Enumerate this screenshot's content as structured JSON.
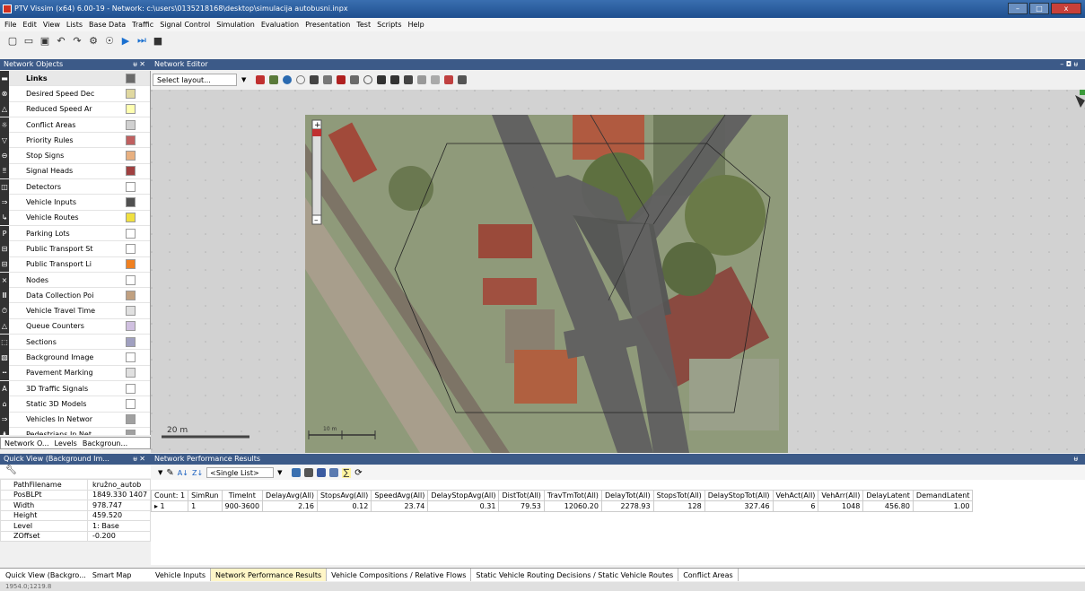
{
  "window": {
    "title": "PTV Vissim (x64) 6.00-19 - Network: c:\\users\\0135218168\\desktop\\simulacija autobusni.inpx",
    "buttons": [
      "–",
      "□",
      "x"
    ]
  },
  "menu": [
    "File",
    "Edit",
    "View",
    "Lists",
    "Base Data",
    "Traffic",
    "Signal Control",
    "Simulation",
    "Evaluation",
    "Presentation",
    "Test",
    "Scripts",
    "Help"
  ],
  "toolbar_icons": [
    "new-icon",
    "open-icon",
    "save-icon",
    "undo-icon",
    "redo-icon",
    "settings-icon",
    "run-icon",
    "play-icon",
    "step-icon",
    "stop-icon"
  ],
  "network_objects": {
    "title": "Network Objects",
    "pin": "ᵾ ✕",
    "items": [
      {
        "label": "Links",
        "color": "#6a6a6a",
        "icon": "▬",
        "selected": true
      },
      {
        "label": "Desired Speed Dec",
        "color": "#e0d8a0",
        "icon": "⊗"
      },
      {
        "label": "Reduced Speed Ar",
        "color": "#ffffb0",
        "icon": "△"
      },
      {
        "label": "Conflict Areas",
        "color": "#d0d0d0",
        "icon": "☼"
      },
      {
        "label": "Priority Rules",
        "color": "#c06060",
        "icon": "▽"
      },
      {
        "label": "Stop Signs",
        "color": "#e8b080",
        "icon": "⊖"
      },
      {
        "label": "Signal Heads",
        "color": "#a04040",
        "icon": "‼"
      },
      {
        "label": "Detectors",
        "color": "#ffffff",
        "icon": "◫"
      },
      {
        "label": "Vehicle Inputs",
        "color": "#505050",
        "icon": "⇒"
      },
      {
        "label": "Vehicle Routes",
        "color": "#f0e040",
        "icon": "↳"
      },
      {
        "label": "Parking Lots",
        "color": "#ffffff",
        "icon": "P"
      },
      {
        "label": "Public Transport St",
        "color": "#ffffff",
        "icon": "⊟"
      },
      {
        "label": "Public Transport Li",
        "color": "#f08020",
        "icon": "⊟"
      },
      {
        "label": "Nodes",
        "color": "#ffffff",
        "icon": "⨯"
      },
      {
        "label": "Data Collection Poi",
        "color": "#c0a080",
        "icon": "Ⅲ"
      },
      {
        "label": "Vehicle Travel Time",
        "color": "#e0e0e0",
        "icon": "⏱"
      },
      {
        "label": "Queue Counters",
        "color": "#d0c0e0",
        "icon": "△"
      },
      {
        "label": "Sections",
        "color": "#a0a0c0",
        "icon": "⬚"
      },
      {
        "label": "Background Image",
        "color": "#ffffff",
        "icon": "▧"
      },
      {
        "label": "Pavement Marking",
        "color": "#e0e0e0",
        "icon": "┅"
      },
      {
        "label": "3D Traffic Signals",
        "color": "#ffffff",
        "icon": "A"
      },
      {
        "label": "Static 3D Models",
        "color": "#ffffff",
        "icon": "⌂"
      },
      {
        "label": "Vehicles In Networ",
        "color": "#a0a0a0",
        "icon": "⇒"
      },
      {
        "label": "Pedestrians In Net",
        "color": "#a0a0a0",
        "icon": "♟"
      }
    ],
    "tabs": [
      "Network O...",
      "Levels",
      "Backgroun..."
    ]
  },
  "quick_view": {
    "title": "Quick View (Background Im...",
    "pin": "ᵾ ✕",
    "rows": [
      {
        "key": "PathFilename",
        "value": "kružno_autob"
      },
      {
        "key": "PosBLPt",
        "value": "1849.330 1407"
      },
      {
        "key": "Width",
        "value": "978.747"
      },
      {
        "key": "Height",
        "value": "459.520"
      },
      {
        "key": "Level",
        "value": "1: Base"
      },
      {
        "key": "ZOffset",
        "value": "-0.200"
      }
    ],
    "tabs": [
      "Quick View (Backgro...",
      "Smart Map"
    ]
  },
  "network_editor": {
    "title": "Network Editor",
    "layout_placeholder": "Select layout...",
    "window_controls": "– ◘ ᵾ",
    "scale_left": "20 m",
    "scale_inner": "10 m"
  },
  "results": {
    "title": "Network Performance Results",
    "pin": "ᵾ",
    "list_select": "<Single List>",
    "columns": [
      "Count: 1",
      "SimRun",
      "TimeInt",
      "DelayAvg(All)",
      "StopsAvg(All)",
      "SpeedAvg(All)",
      "DelayStopAvg(All)",
      "DistTot(All)",
      "TravTmTot(All)",
      "DelayTot(All)",
      "StopsTot(All)",
      "DelayStopTot(All)",
      "VehAct(All)",
      "VehArr(All)",
      "DelayLatent",
      "DemandLatent"
    ],
    "row": [
      "▸ 1",
      "1",
      "900-3600",
      "2.16",
      "0.12",
      "23.74",
      "0.31",
      "79.53",
      "12060.20",
      "2278.93",
      "128",
      "327.46",
      "6",
      "1048",
      "456.80",
      "1.00"
    ]
  },
  "bottom_tabs": [
    {
      "label": "Vehicle Inputs",
      "active": false
    },
    {
      "label": "Network Performance Results",
      "active": true
    },
    {
      "label": "Vehicle Compositions / Relative Flows",
      "active": false
    },
    {
      "label": "Static Vehicle Routing Decisions / Static Vehicle Routes",
      "active": false
    },
    {
      "label": "Conflict Areas",
      "active": false
    }
  ],
  "status": "1954.0;1219.8"
}
